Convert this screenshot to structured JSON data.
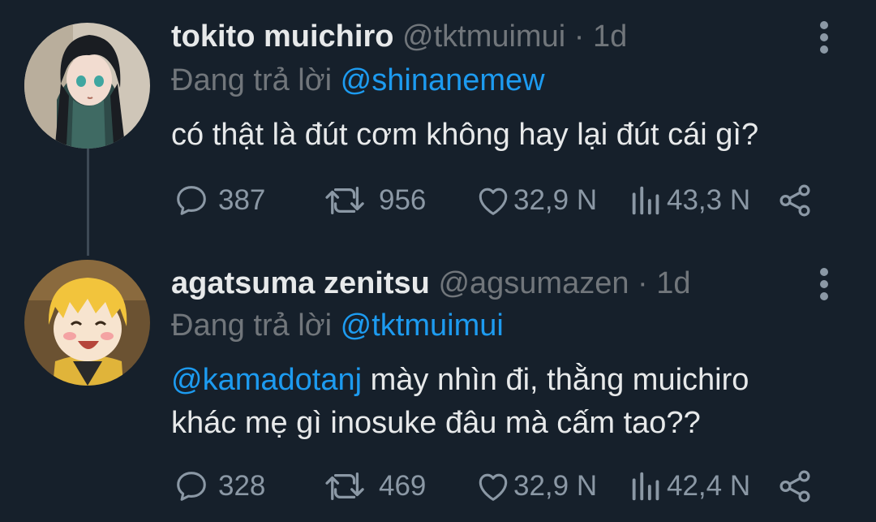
{
  "theme": {
    "background": "#16202b",
    "text": "#e7e9ea",
    "muted": "#71767b",
    "accent": "#1d9bf0"
  },
  "tweets": [
    {
      "display_name": "tokito muichiro",
      "handle": "@tktmuimui",
      "separator": "·",
      "time": "1d",
      "reply_prefix": "Đang trả lời",
      "reply_to": "@shinanemew",
      "body_line1": "có thật là đút cơm không hay lại đút cái gì?",
      "replies": "387",
      "retweets": "956",
      "likes": "32,9 N",
      "views": "43,3 N",
      "avatar": "avatar-dark-hair-character"
    },
    {
      "display_name": "agatsuma zenitsu",
      "handle": "@agsumazen",
      "separator": "·",
      "time": "1d",
      "reply_prefix": "Đang trả lời",
      "reply_to": "@tktmuimui",
      "body_mention": "@kamadotanj",
      "body_line1_rest": " mày nhìn đi, thằng muichiro",
      "body_line2": "khác mẹ gì inosuke đâu mà cấm tao??",
      "replies": "328",
      "retweets": "469",
      "likes": "32,9 N",
      "views": "42,4 N",
      "avatar": "avatar-blonde-character"
    }
  ],
  "icons": {
    "reply": "speech-bubble-icon",
    "retweet": "retweet-icon",
    "like": "heart-icon",
    "views": "bar-chart-icon",
    "share": "share-icon",
    "more": "vertical-dots-icon"
  }
}
